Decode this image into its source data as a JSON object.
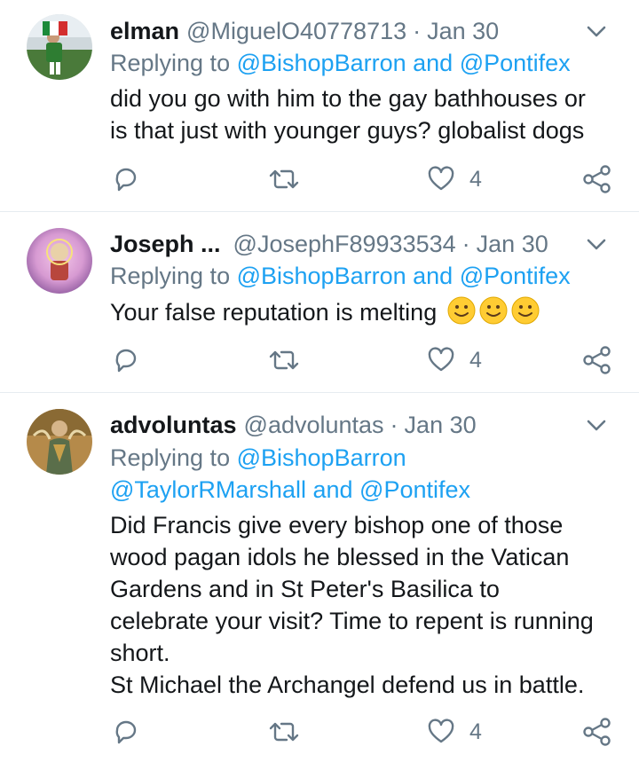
{
  "tweets": [
    {
      "name": "elman",
      "handle": "@MiguelO40778713",
      "separator": "·",
      "date": "Jan 30",
      "replying_prefix": "Replying to",
      "mention1": "@BishopBarron",
      "and1": " and ",
      "mention2": "@Pontifex",
      "text_line1": "did you go with him to the gay bathhouses or",
      "text_line2": "is that just with younger guys? globalist dogs",
      "like_count": "4"
    },
    {
      "name": "Joseph ...",
      "handle": "@JosephF89933534",
      "separator": "·",
      "date": "Jan 30",
      "replying_prefix": "Replying to",
      "mention1": "@BishopBarron",
      "and1": " and ",
      "mention2": "@Pontifex",
      "text_line1": "Your false reputation is melting",
      "emojis": [
        "slightly-smiling-face",
        "slightly-smiling-face",
        "slightly-smiling-face"
      ],
      "like_count": "4"
    },
    {
      "name": "advoluntas",
      "handle": "@advoluntas",
      "separator": "·",
      "date": "Jan 30",
      "replying_prefix": "Replying to",
      "mention1": "@BishopBarron",
      "mention2": "@TaylorRMarshall",
      "and1": " and ",
      "mention3": "@Pontifex",
      "text_line1": "Did Francis give every bishop one of those",
      "text_line2": "wood pagan idols he blessed in the Vatican",
      "text_line3": "Gardens and in St Peter's Basilica to",
      "text_line4": "celebrate your visit? Time to repent is running",
      "text_line5": "short.",
      "text_line6": "St Michael the Archangel defend us in battle.",
      "like_count": "4"
    }
  ],
  "icons": {
    "reply": "reply-icon",
    "retweet": "retweet-icon",
    "like": "heart-icon",
    "share": "share-icon",
    "menu": "chevron-down-icon"
  },
  "colors": {
    "link": "#1da1f2",
    "secondary": "#657786",
    "divider": "#e6ecf0"
  }
}
